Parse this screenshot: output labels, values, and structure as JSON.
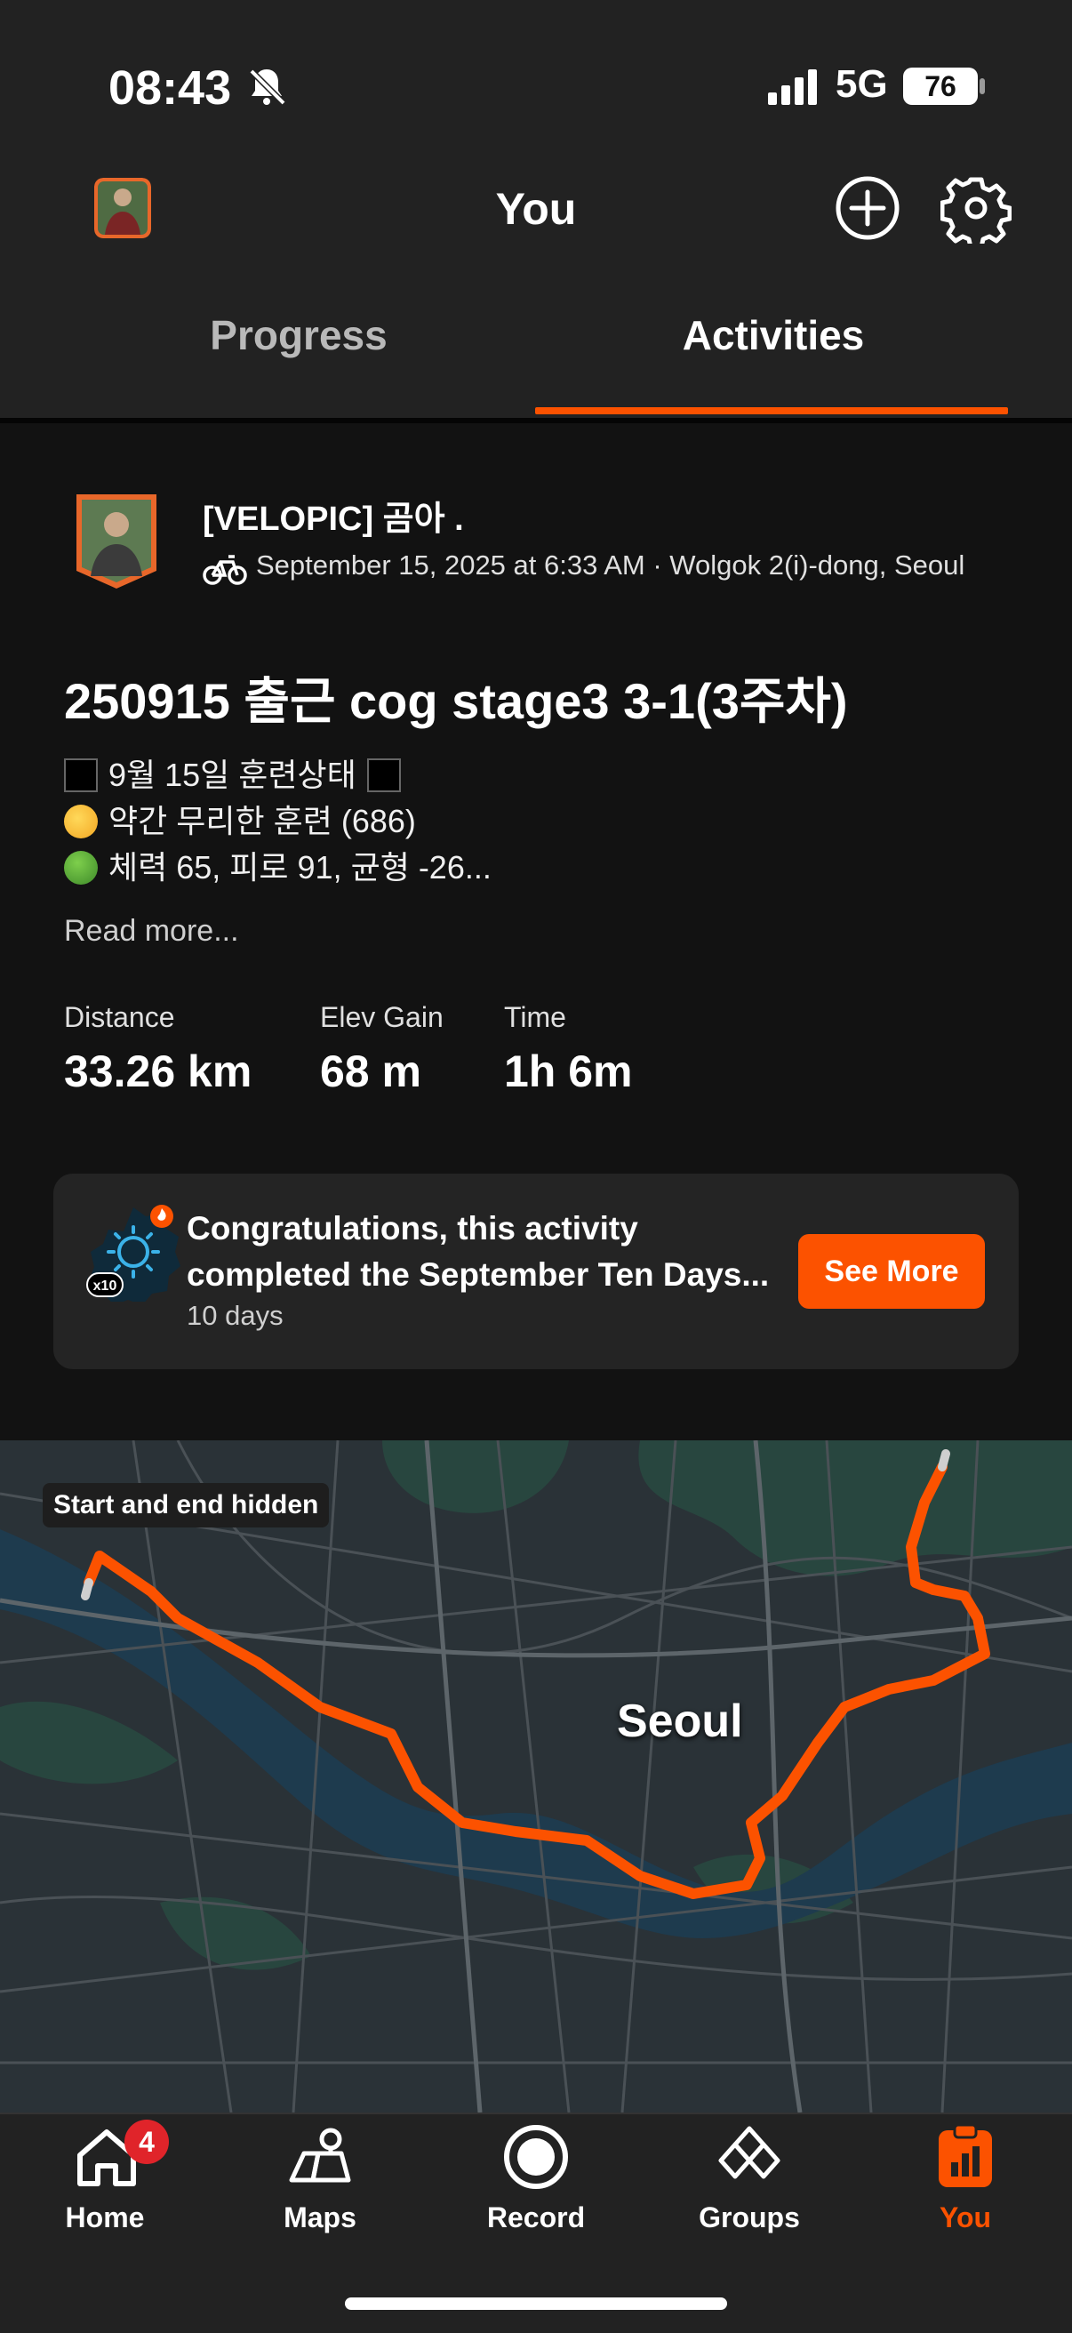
{
  "status_bar": {
    "time": "08:43",
    "network": "5G",
    "battery": "76"
  },
  "header": {
    "title": "You"
  },
  "tabs": [
    {
      "label": "Progress"
    },
    {
      "label": "Activities"
    }
  ],
  "activity": {
    "athlete": "[VELOPIC] 곰아 .",
    "meta": "September 15, 2025 at 6:33 AM · Wolgok 2(i)-dong, Seoul",
    "title": "250915 출근 cog stage3 3-1(3주차)",
    "description": [
      "9월 15일 훈련상태",
      "약간 무리한 훈련 (686)",
      "체력 65, 피로 91, 균형 -26..."
    ],
    "read_more": "Read more...",
    "stats": [
      {
        "label": "Distance",
        "value": "33.26 km"
      },
      {
        "label": "Elev Gain",
        "value": "68 m"
      },
      {
        "label": "Time",
        "value": "1h 6m"
      }
    ]
  },
  "challenge": {
    "title": "Congratulations, this activity completed the September Ten Days...",
    "subtitle": "10 days",
    "badge_count": "x10",
    "button": "See More"
  },
  "map": {
    "chip": "Start and end hidden",
    "city_label": "Seoul",
    "route_color": "#fc5200"
  },
  "nav": [
    {
      "label": "Home",
      "icon": "home-icon",
      "badge": "4"
    },
    {
      "label": "Maps",
      "icon": "maps-icon"
    },
    {
      "label": "Record",
      "icon": "record-icon"
    },
    {
      "label": "Groups",
      "icon": "groups-icon"
    },
    {
      "label": "You",
      "icon": "you-icon",
      "active": true
    }
  ],
  "colors": {
    "accent": "#fc5200",
    "background": "#121212",
    "surface": "#222222"
  }
}
